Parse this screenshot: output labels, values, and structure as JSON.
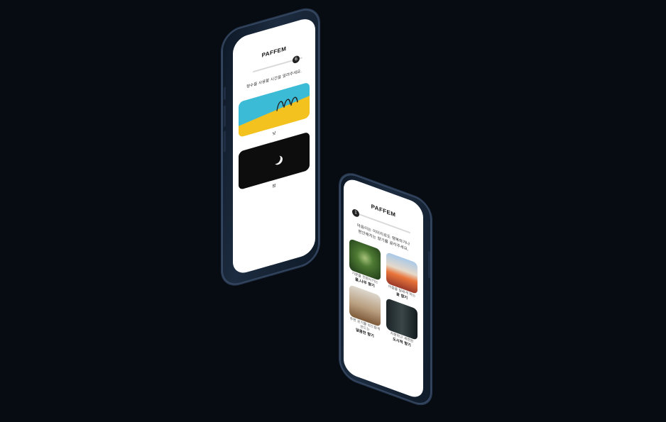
{
  "screen1": {
    "brand": "PAFFEM",
    "step": "6",
    "question": "향수를 사용할 시간을 알려주세요.",
    "options": [
      {
        "label": "낮"
      },
      {
        "label": "밤"
      }
    ]
  },
  "screen2": {
    "brand": "PAFFEM",
    "step": "1",
    "question_line1": "마음리는 이미지로도 행복하거나",
    "question_line2": "편안해지는 향기를 골라주세요.",
    "tiles": [
      {
        "caption": "기분을 전환시키는",
        "title": "풀,나무 향기"
      },
      {
        "caption": "마음을 달래게 하는",
        "title": "꽃 향기"
      },
      {
        "caption": "주변 공기를 보드랍게 만드는",
        "title": "달콤한 향기"
      },
      {
        "caption": "차분하고 세련된",
        "title": "도시적 향기"
      }
    ]
  }
}
